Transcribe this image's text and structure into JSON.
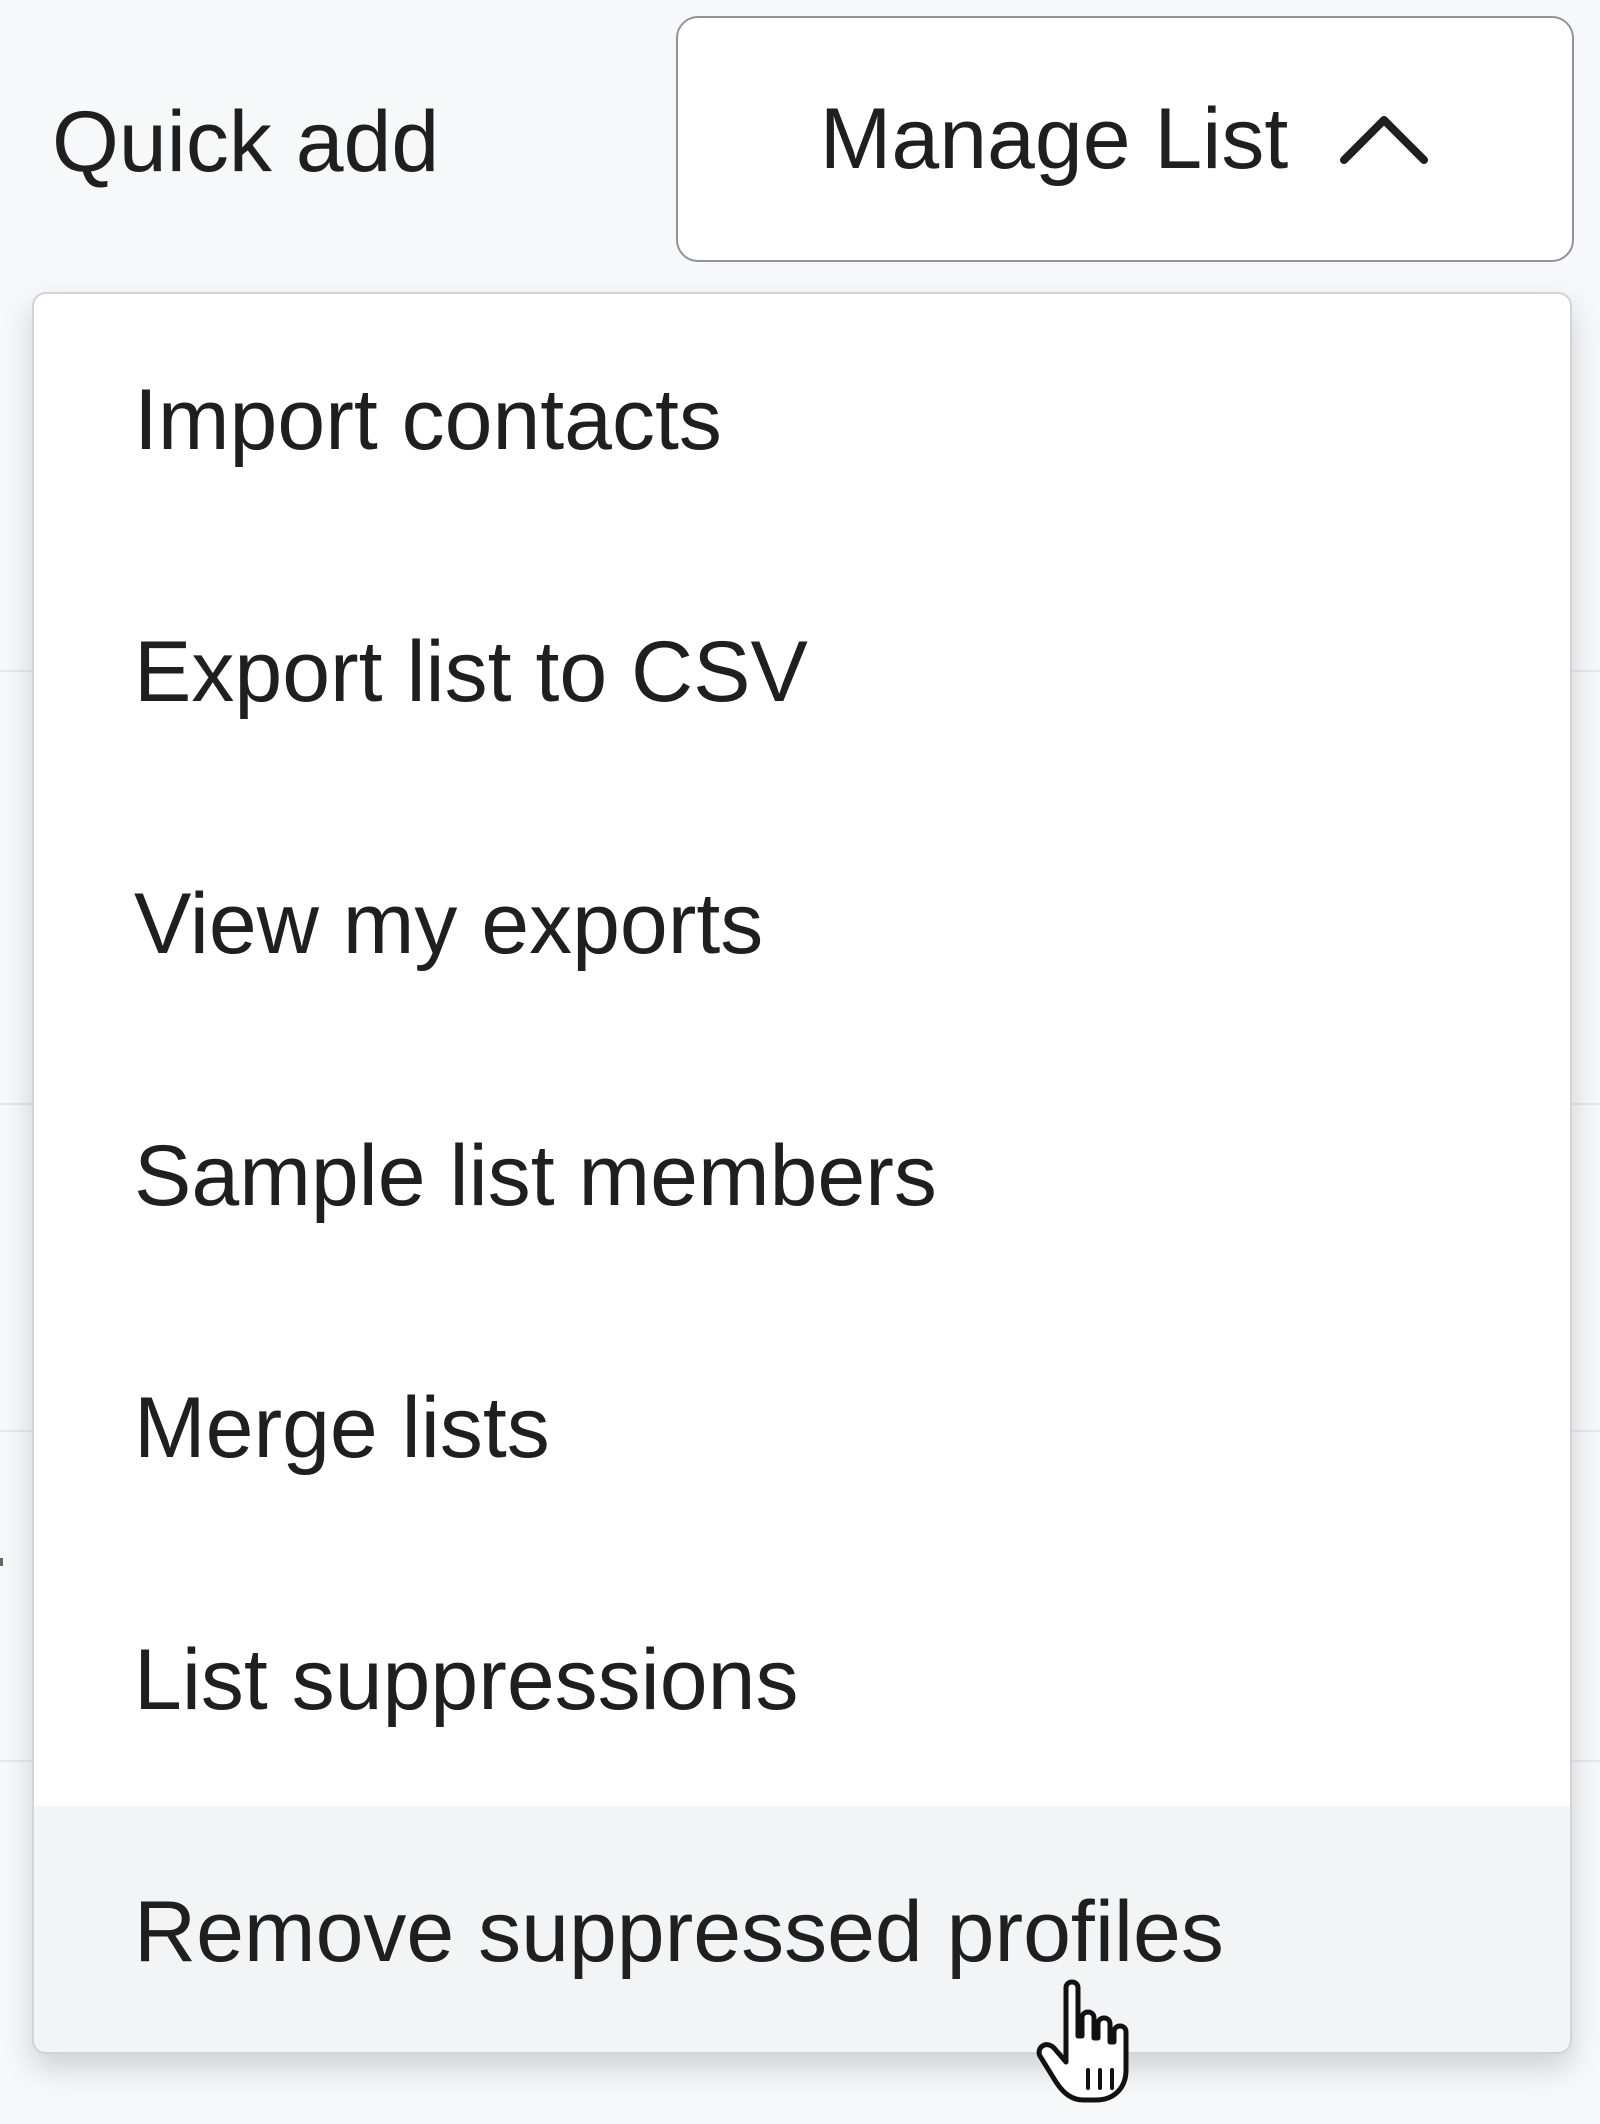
{
  "toolbar": {
    "quick_add_label": "Quick add",
    "manage_list_label": "Manage List",
    "manage_list_icon": "chevron-up-icon"
  },
  "menu": {
    "items": [
      {
        "label": "Import contacts"
      },
      {
        "label": "Export list to CSV"
      },
      {
        "label": "View my exports"
      },
      {
        "label": "Sample list members"
      },
      {
        "label": "Merge lists"
      },
      {
        "label": "List suppressions"
      },
      {
        "label": "Remove suppressed profiles",
        "hovered": true
      }
    ]
  },
  "cursor": {
    "icon": "hand-pointer-icon"
  },
  "colors": {
    "text": "#1f1f1f",
    "border": "#8f949a",
    "hover_bg": "#f3f4f6",
    "menu_bg": "#ffffff"
  }
}
